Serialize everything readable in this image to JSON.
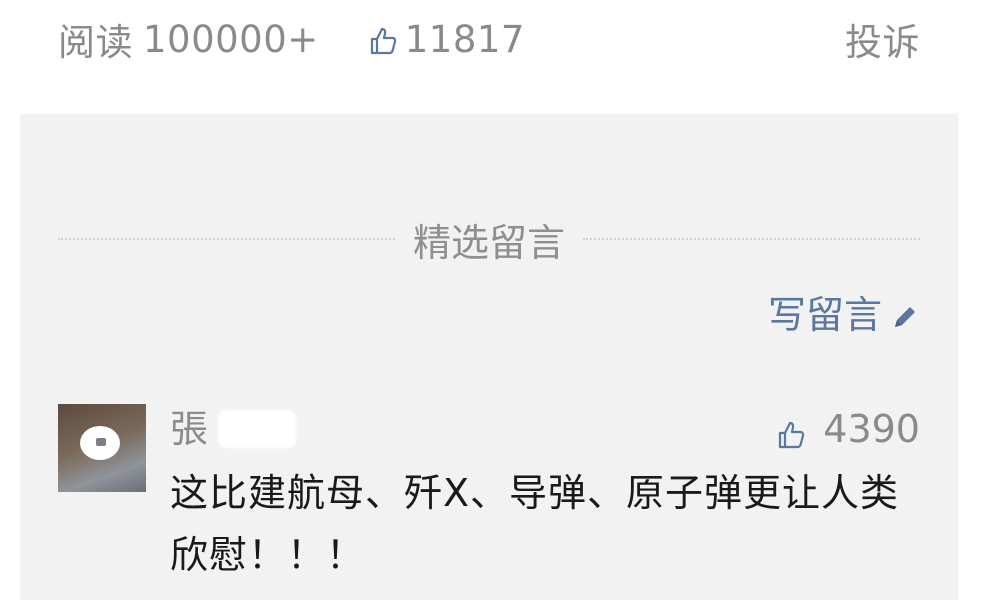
{
  "stats": {
    "read_label": "阅读",
    "read_value": "100000+",
    "like_icon": "thumbs-up-icon",
    "like_value": "11817",
    "report_label": "投诉"
  },
  "comments_section": {
    "title": "精选留言",
    "write_label": "写留言",
    "write_icon": "pencil-icon"
  },
  "comments": [
    {
      "avatar_icon": "avatar-photo",
      "name": "張",
      "like_icon": "thumbs-up-icon",
      "like_count": "4390",
      "text": "这比建航母、歼X、导弹、原子弹更让人类欣慰！！！"
    }
  ],
  "colors": {
    "muted_text": "#8a8a8a",
    "link_blue": "#5a77a0",
    "panel_bg": "#f2f2f2",
    "body_text": "#1a1a1a"
  }
}
